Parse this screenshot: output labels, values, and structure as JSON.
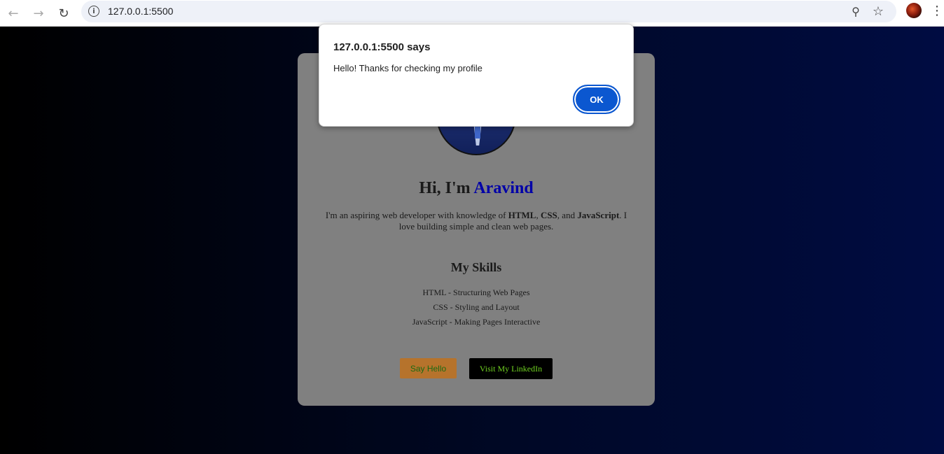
{
  "browser": {
    "url": "127.0.0.1:5500",
    "icons": {
      "back": "arrow-left-icon",
      "forward": "arrow-right-icon",
      "reload": "reload-icon",
      "site_info": "info-icon",
      "zoom": "zoom-icon",
      "bookmark": "star-icon",
      "profile": "avatar",
      "menu": "kebab-menu-icon"
    }
  },
  "dialog": {
    "title": "127.0.0.1:5500 says",
    "message": "Hello! Thanks for checking my profile",
    "ok_label": "OK"
  },
  "profile": {
    "heading_prefix": "Hi, I'm ",
    "name": "Aravind",
    "intro_start": "I'm an aspiring web developer with knowledge of ",
    "intro_html": "HTML",
    "intro_sep1": ", ",
    "intro_css": "CSS",
    "intro_sep2": ", and ",
    "intro_js": "JavaScript",
    "intro_end": ". I love building simple and clean web pages.",
    "skills_title": "My Skills",
    "skills": [
      "HTML - Structuring Web Pages",
      "CSS - Styling and Layout",
      "JavaScript - Making Pages Interactive"
    ],
    "say_hello_label": "Say Hello",
    "linkedin_label": "Visit My LinkedIn"
  },
  "colors": {
    "card_bg": "#808080",
    "name_accent": "#0000a8",
    "say_hello_bg": "#b6732c",
    "linkedin_bg": "#000000",
    "linkedin_text": "#6fd020",
    "dialog_button": "#0b57d0"
  }
}
